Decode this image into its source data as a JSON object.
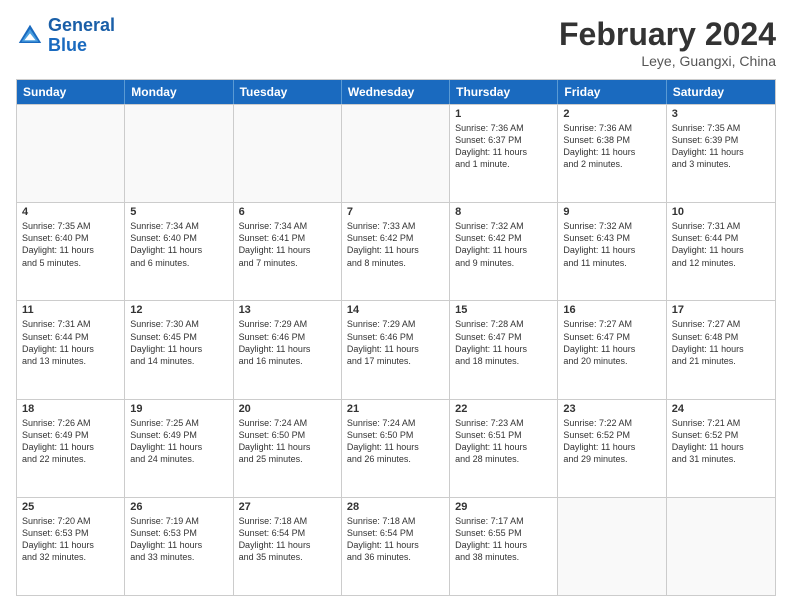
{
  "header": {
    "logo_line1": "General",
    "logo_line2": "Blue",
    "month_year": "February 2024",
    "location": "Leye, Guangxi, China"
  },
  "weekdays": [
    "Sunday",
    "Monday",
    "Tuesday",
    "Wednesday",
    "Thursday",
    "Friday",
    "Saturday"
  ],
  "rows": [
    [
      {
        "day": "",
        "info": ""
      },
      {
        "day": "",
        "info": ""
      },
      {
        "day": "",
        "info": ""
      },
      {
        "day": "",
        "info": ""
      },
      {
        "day": "1",
        "info": "Sunrise: 7:36 AM\nSunset: 6:37 PM\nDaylight: 11 hours\nand 1 minute."
      },
      {
        "day": "2",
        "info": "Sunrise: 7:36 AM\nSunset: 6:38 PM\nDaylight: 11 hours\nand 2 minutes."
      },
      {
        "day": "3",
        "info": "Sunrise: 7:35 AM\nSunset: 6:39 PM\nDaylight: 11 hours\nand 3 minutes."
      }
    ],
    [
      {
        "day": "4",
        "info": "Sunrise: 7:35 AM\nSunset: 6:40 PM\nDaylight: 11 hours\nand 5 minutes."
      },
      {
        "day": "5",
        "info": "Sunrise: 7:34 AM\nSunset: 6:40 PM\nDaylight: 11 hours\nand 6 minutes."
      },
      {
        "day": "6",
        "info": "Sunrise: 7:34 AM\nSunset: 6:41 PM\nDaylight: 11 hours\nand 7 minutes."
      },
      {
        "day": "7",
        "info": "Sunrise: 7:33 AM\nSunset: 6:42 PM\nDaylight: 11 hours\nand 8 minutes."
      },
      {
        "day": "8",
        "info": "Sunrise: 7:32 AM\nSunset: 6:42 PM\nDaylight: 11 hours\nand 9 minutes."
      },
      {
        "day": "9",
        "info": "Sunrise: 7:32 AM\nSunset: 6:43 PM\nDaylight: 11 hours\nand 11 minutes."
      },
      {
        "day": "10",
        "info": "Sunrise: 7:31 AM\nSunset: 6:44 PM\nDaylight: 11 hours\nand 12 minutes."
      }
    ],
    [
      {
        "day": "11",
        "info": "Sunrise: 7:31 AM\nSunset: 6:44 PM\nDaylight: 11 hours\nand 13 minutes."
      },
      {
        "day": "12",
        "info": "Sunrise: 7:30 AM\nSunset: 6:45 PM\nDaylight: 11 hours\nand 14 minutes."
      },
      {
        "day": "13",
        "info": "Sunrise: 7:29 AM\nSunset: 6:46 PM\nDaylight: 11 hours\nand 16 minutes."
      },
      {
        "day": "14",
        "info": "Sunrise: 7:29 AM\nSunset: 6:46 PM\nDaylight: 11 hours\nand 17 minutes."
      },
      {
        "day": "15",
        "info": "Sunrise: 7:28 AM\nSunset: 6:47 PM\nDaylight: 11 hours\nand 18 minutes."
      },
      {
        "day": "16",
        "info": "Sunrise: 7:27 AM\nSunset: 6:47 PM\nDaylight: 11 hours\nand 20 minutes."
      },
      {
        "day": "17",
        "info": "Sunrise: 7:27 AM\nSunset: 6:48 PM\nDaylight: 11 hours\nand 21 minutes."
      }
    ],
    [
      {
        "day": "18",
        "info": "Sunrise: 7:26 AM\nSunset: 6:49 PM\nDaylight: 11 hours\nand 22 minutes."
      },
      {
        "day": "19",
        "info": "Sunrise: 7:25 AM\nSunset: 6:49 PM\nDaylight: 11 hours\nand 24 minutes."
      },
      {
        "day": "20",
        "info": "Sunrise: 7:24 AM\nSunset: 6:50 PM\nDaylight: 11 hours\nand 25 minutes."
      },
      {
        "day": "21",
        "info": "Sunrise: 7:24 AM\nSunset: 6:50 PM\nDaylight: 11 hours\nand 26 minutes."
      },
      {
        "day": "22",
        "info": "Sunrise: 7:23 AM\nSunset: 6:51 PM\nDaylight: 11 hours\nand 28 minutes."
      },
      {
        "day": "23",
        "info": "Sunrise: 7:22 AM\nSunset: 6:52 PM\nDaylight: 11 hours\nand 29 minutes."
      },
      {
        "day": "24",
        "info": "Sunrise: 7:21 AM\nSunset: 6:52 PM\nDaylight: 11 hours\nand 31 minutes."
      }
    ],
    [
      {
        "day": "25",
        "info": "Sunrise: 7:20 AM\nSunset: 6:53 PM\nDaylight: 11 hours\nand 32 minutes."
      },
      {
        "day": "26",
        "info": "Sunrise: 7:19 AM\nSunset: 6:53 PM\nDaylight: 11 hours\nand 33 minutes."
      },
      {
        "day": "27",
        "info": "Sunrise: 7:18 AM\nSunset: 6:54 PM\nDaylight: 11 hours\nand 35 minutes."
      },
      {
        "day": "28",
        "info": "Sunrise: 7:18 AM\nSunset: 6:54 PM\nDaylight: 11 hours\nand 36 minutes."
      },
      {
        "day": "29",
        "info": "Sunrise: 7:17 AM\nSunset: 6:55 PM\nDaylight: 11 hours\nand 38 minutes."
      },
      {
        "day": "",
        "info": ""
      },
      {
        "day": "",
        "info": ""
      }
    ]
  ]
}
